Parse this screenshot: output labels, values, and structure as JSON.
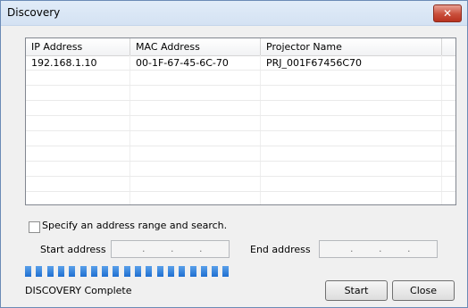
{
  "window": {
    "title": "Discovery",
    "close_glyph": "✕"
  },
  "table": {
    "columns": [
      "IP Address",
      "MAC Address",
      "Projector Name"
    ],
    "rows": [
      [
        "192.168.1.10",
        "00-1F-67-45-6C-70",
        "PRJ_001F67456C70"
      ]
    ]
  },
  "range": {
    "checkbox_label": "Specify an address range and search.",
    "checked": false,
    "start_label": "Start address",
    "end_label": "End address",
    "start_value": ". . .",
    "end_value": ". . ."
  },
  "progress": {
    "segments_filled": 19,
    "segments_total": 19,
    "fraction": 1.0
  },
  "status_text": "DISCOVERY Complete",
  "buttons": {
    "start": "Start",
    "close": "Close"
  },
  "colors": {
    "progress": "#1f6fd0",
    "close_button": "#c94f3b"
  }
}
